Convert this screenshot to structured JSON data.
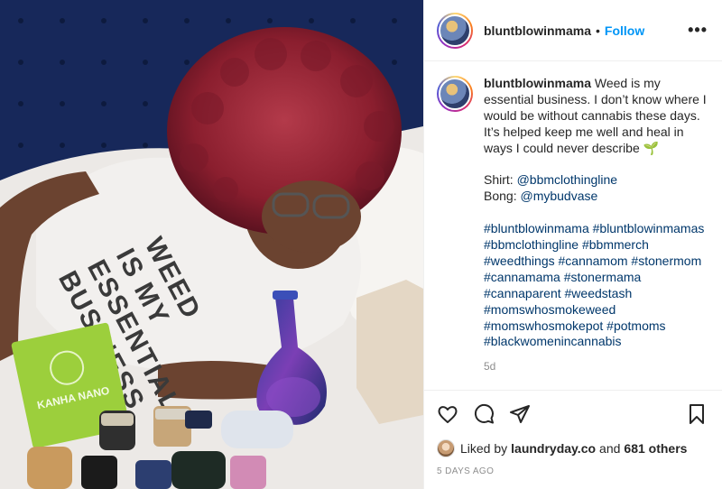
{
  "post": {
    "username": "bluntblowinmama",
    "follow_label": "Follow",
    "separator": "•",
    "more_label": "•••"
  },
  "caption": {
    "username": "bluntblowinmama",
    "text_line1": "Weed is my essential business. I don’t know where I would be without cannabis these days. It’s helped keep me well and heal in ways I could never describe",
    "emoji": "🌱",
    "shirt_label": "Shirt:",
    "shirt_handle": "@bbmclothingline",
    "bong_label": "Bong:",
    "bong_handle": "@mybudvase",
    "hashtags": "#bluntblowinmama #bluntblowinmamas #bbmclothingline #bbmmerch #weedthings #cannamom #stonermom #cannamama #stonermama #cannaparent #weedstash #momswhosmokeweed #momswhosmokepot #potmoms #blackwomenincannabis",
    "time": "5d"
  },
  "likes": {
    "prefix": "Liked by",
    "liker": "laundryday.co",
    "and": "and",
    "others": "681 others"
  },
  "date": "5 DAYS AGO",
  "photo": {
    "shirt_text": "WEED IS MY ESSENTIAL BUSINESS",
    "package_text": "KANHA NANO"
  },
  "colors": {
    "link": "#00376b",
    "follow": "#0095f6",
    "muted": "#8e8e8e"
  }
}
